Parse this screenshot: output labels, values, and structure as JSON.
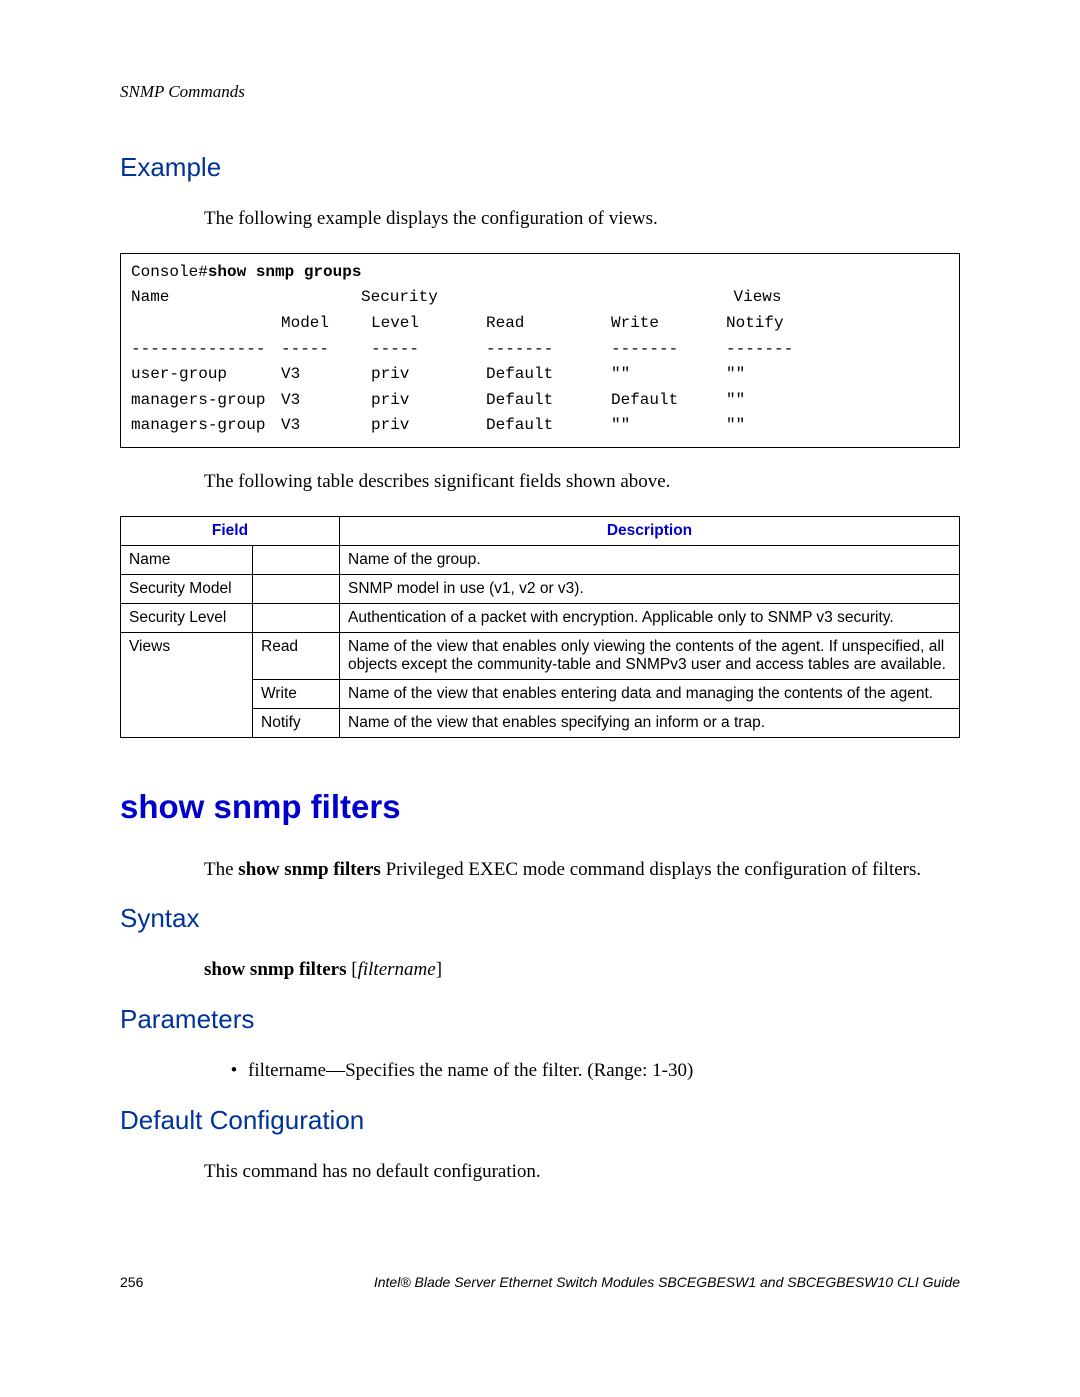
{
  "running_header": "SNMP Commands",
  "section_example": "Example",
  "example_intro": "The following example displays the configuration of views.",
  "console": {
    "prompt": "Console# ",
    "command": "show snmp groups",
    "header": {
      "name": "Name",
      "security": "Security",
      "views": "Views",
      "model": "Model",
      "level": "Level",
      "read": "Read",
      "write": "Write",
      "notify": "Notify"
    },
    "sep": {
      "c1": "--------------",
      "c2": "-----",
      "c3": "-----",
      "c4": "-------",
      "c5": "-------",
      "c6": "-------"
    },
    "rows": [
      {
        "c1": "user-group",
        "c2": "V3",
        "c3": "priv",
        "c4": "Default",
        "c5": "\"\"",
        "c6": "\"\""
      },
      {
        "c1": "managers-group",
        "c2": "V3",
        "c3": "priv",
        "c4": "Default",
        "c5": "Default",
        "c6": "\"\""
      },
      {
        "c1": "managers-group",
        "c2": "V3",
        "c3": "priv",
        "c4": "Default",
        "c5": "\"\"",
        "c6": "\"\""
      }
    ]
  },
  "table_intro": "The following table describes significant fields shown above.",
  "field_table": {
    "head_field": "Field",
    "head_desc": "Description",
    "rows": [
      {
        "a": "Name",
        "b": "",
        "c": "Name of the group."
      },
      {
        "a": "Security Model",
        "b": "",
        "c": "SNMP model in use (v1, v2 or v3)."
      },
      {
        "a": "Security Level",
        "b": "",
        "c": "Authentication of a packet with encryption. Applicable only to SNMP v3 security."
      },
      {
        "a": "Views",
        "b": "Read",
        "c": "Name of the view that enables only viewing the contents of the agent. If unspecified, all objects except the community-table and SNMPv3 user and access tables are available."
      },
      {
        "a": "",
        "b": "Write",
        "c": "Name of the view that enables entering data and managing the contents of the agent."
      },
      {
        "a": "",
        "b": "Notify",
        "c": "Name of the view that enables specifying an inform or a trap."
      }
    ]
  },
  "command_title": "show snmp filters",
  "command_intro_1": "The ",
  "command_intro_bold": "show snmp filters",
  "command_intro_2": " Privileged EXEC mode command displays the configuration of filters.",
  "section_syntax": "Syntax",
  "syntax_bold": "show snmp filters",
  "syntax_italic": "filtername",
  "section_parameters": "Parameters",
  "param_italic": "filtername",
  "param_text": "—Specifies the name of the filter. (Range: 1-30)",
  "section_default": "Default Configuration",
  "default_text": "This command has no default configuration.",
  "footer_page": "256",
  "footer_title": "Intel® Blade Server Ethernet Switch Modules SBCEGBESW1 and SBCEGBESW10 CLI Guide"
}
